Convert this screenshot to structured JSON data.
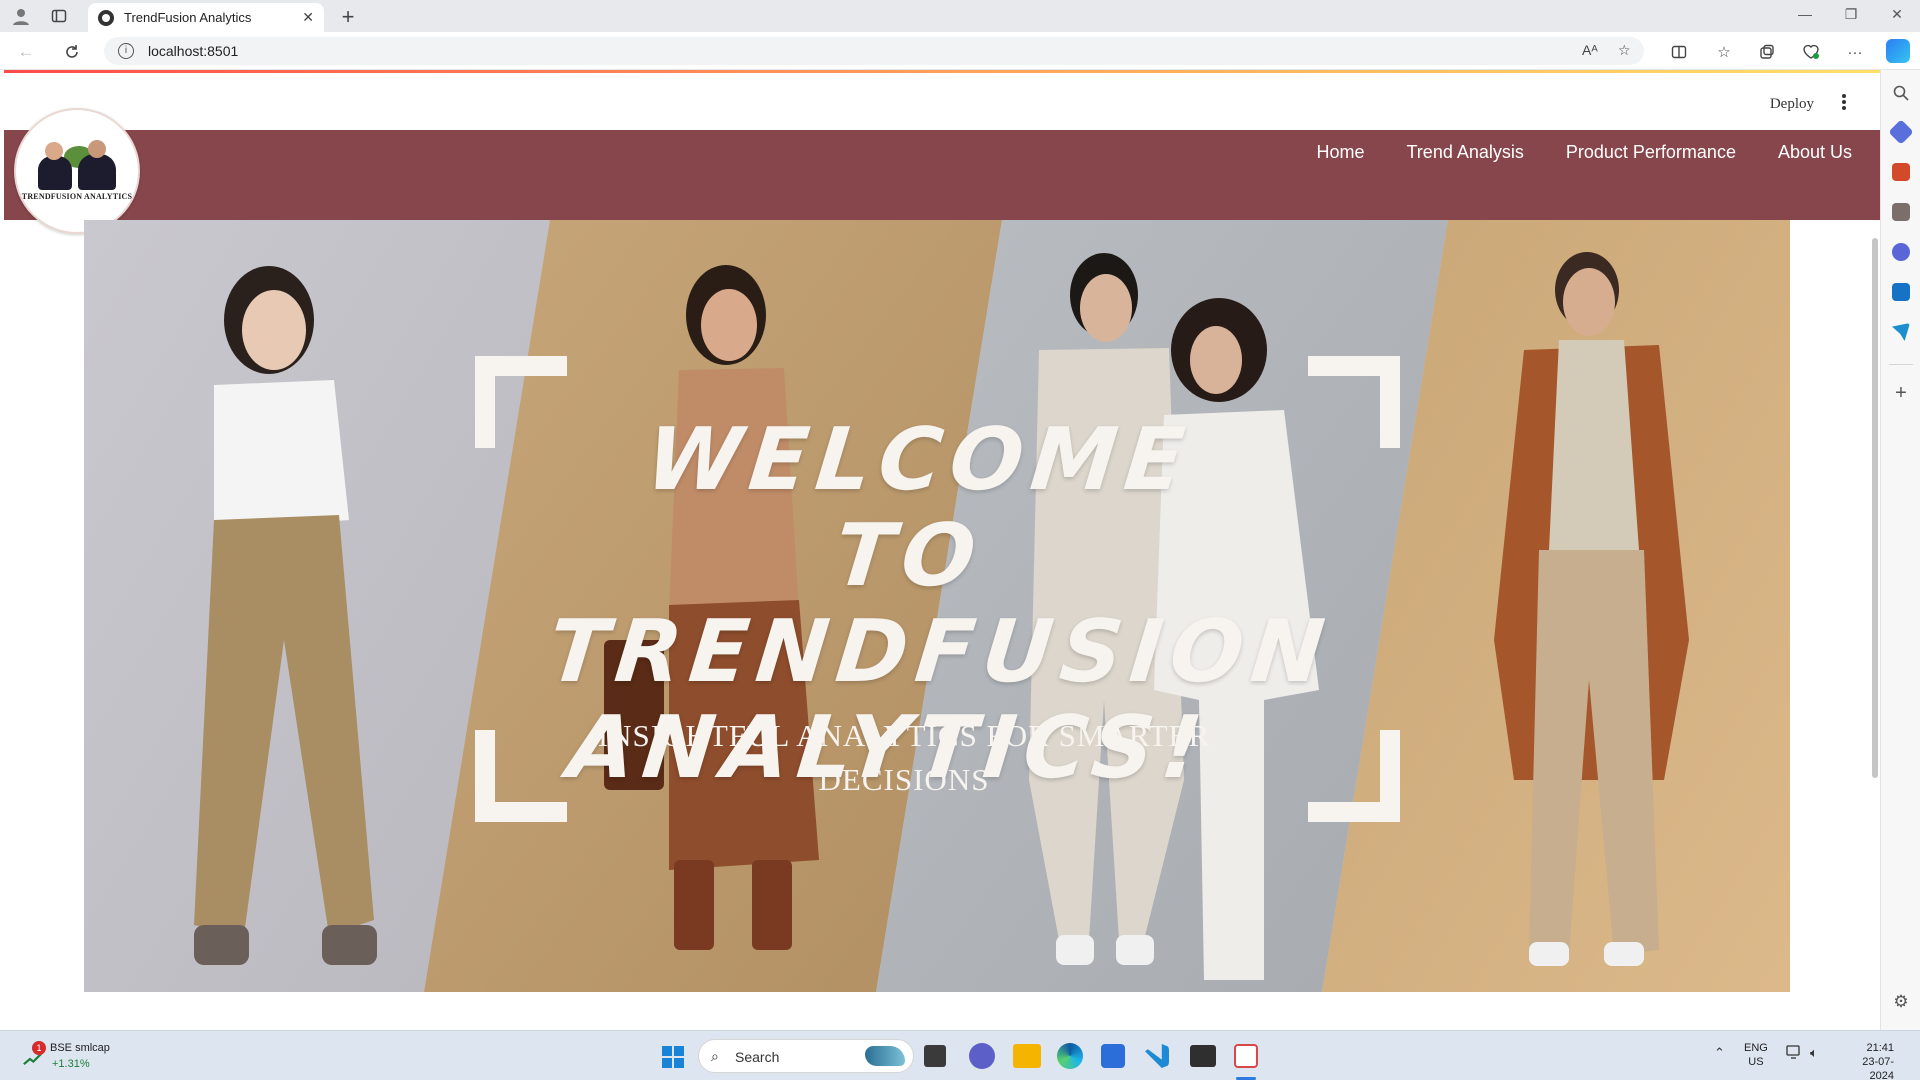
{
  "browser": {
    "tab_title": "TrendFusion Analytics",
    "url": "localhost:8501",
    "read_aloud_label": "Aᴬ"
  },
  "app": {
    "deploy_label": "Deploy",
    "nav": [
      {
        "label": "Home"
      },
      {
        "label": "Trend Analysis"
      },
      {
        "label": "Product Performance"
      },
      {
        "label": "About Us"
      }
    ],
    "logo_text": "TRENDFUSION ANALYTICS",
    "brand_color": "#87464c"
  },
  "hero": {
    "headline_line1": "WELCOME TO",
    "headline_line2": "TRENDFUSION",
    "headline_line3": "ANALYTICS!",
    "subtitle": "INSIGHTFUL ANALYTICS FOR SMARTER DECISIONS"
  },
  "taskbar": {
    "stock_name": "BSE smlcap",
    "stock_change": "+1.31%",
    "stock_badge": "1",
    "search_placeholder": "Search",
    "lang_line1": "ENG",
    "lang_line2": "US",
    "time": "21:41",
    "date": "23-07-2024"
  }
}
